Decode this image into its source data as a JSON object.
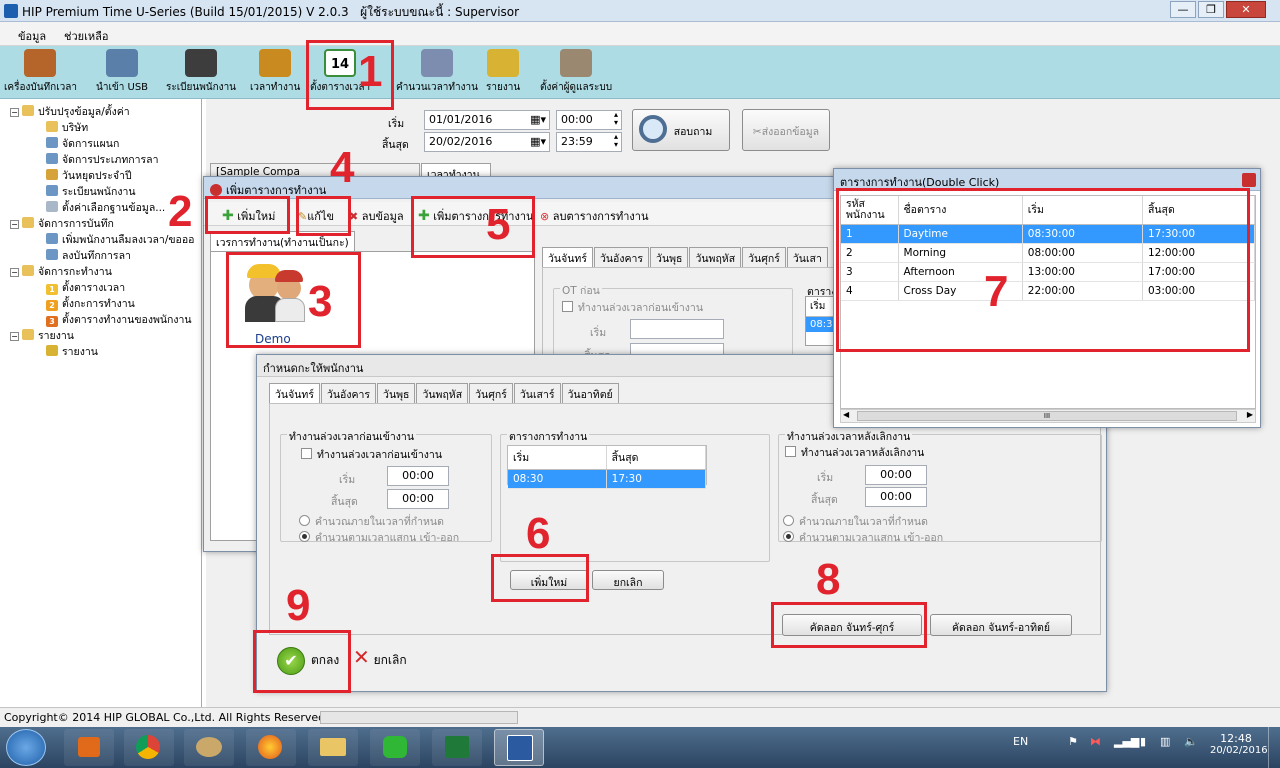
{
  "app": {
    "title": "HIP Premium Time U-Series (Build 15/01/2015) V 2.0.3",
    "user_label": "ผู้ใช้ระบบขณะนี้",
    "user": ": Supervisor"
  },
  "window_buttons": {
    "min": "—",
    "max": "❐",
    "close": "✕"
  },
  "menu": [
    "ข้อมูล",
    "ช่วยเหลือ"
  ],
  "toolbar": [
    {
      "label": "เครื่องบันทึกเวลา",
      "icon": "time-clock-icon",
      "color": "#b5652a"
    },
    {
      "label": "นำเข้า USB",
      "icon": "usb-icon",
      "color": "#5a7fa8"
    },
    {
      "label": "ระเบียนพนักงาน",
      "icon": "employees-icon",
      "color": "#3d3d3d"
    },
    {
      "label": "เวลาทำงาน",
      "icon": "stopwatch-icon",
      "color": "#c98a1f"
    },
    {
      "label": "ตั้งตารางเวลา",
      "icon": "calendar-icon",
      "color": "#3a8d3a",
      "cal_day": "14"
    },
    {
      "label": "คำนวนเวลาทำงาน",
      "icon": "document-pen-icon",
      "color": "#7d8db0"
    },
    {
      "label": "รายงาน",
      "icon": "chart-icon",
      "color": "#d8b233"
    },
    {
      "label": "ตั้งค่าผู้ดูแลระบบ",
      "icon": "admin-settings-icon",
      "color": "#9a8870"
    }
  ],
  "tree": [
    {
      "label": "ปรับปรุงข้อมูล/ตั้งค่า",
      "level": 0,
      "exp": "−",
      "color": "#e8c15a"
    },
    {
      "label": "บริษัท",
      "level": 1,
      "color": "#e8c15a"
    },
    {
      "label": "จัดการแผนก",
      "level": 1,
      "color": "#6c96c4"
    },
    {
      "label": "จัดการประเภทการลา",
      "level": 1,
      "color": "#6c96c4"
    },
    {
      "label": "วันหยุดประจำปี",
      "level": 1,
      "color": "#d6a23a"
    },
    {
      "label": "ระเบียนพนักงาน",
      "level": 1,
      "color": "#6c96c4"
    },
    {
      "label": "ตั้งค่าเลือกฐานข้อมูล...",
      "level": 1,
      "color": "#a9b8c8"
    },
    {
      "label": "จัดการการบันทึก",
      "level": 0,
      "exp": "−",
      "color": "#e8c15a"
    },
    {
      "label": "เพิ่มพนักงานลืมลงเวลา/ขอออ",
      "level": 1,
      "color": "#6c96c4"
    },
    {
      "label": "ลงบันทึกการลา",
      "level": 1,
      "color": "#6c96c4"
    },
    {
      "label": "จัดการกะทำงาน",
      "level": 0,
      "exp": "−",
      "color": "#e8c15a"
    },
    {
      "label": "ตั้งตารางเวลา",
      "level": 1,
      "badge": "1",
      "color": "#f0c030"
    },
    {
      "label": "ตั้งกะการทำงาน",
      "level": 1,
      "badge": "2",
      "color": "#f0a020"
    },
    {
      "label": "ตั้งตารางทำงานของพนักงาน",
      "level": 1,
      "badge": "3",
      "color": "#e07020"
    },
    {
      "label": "รายงาน",
      "level": 0,
      "exp": "−",
      "color": "#e8c15a"
    },
    {
      "label": "รายงาน",
      "level": 1,
      "color": "#d8b233"
    }
  ],
  "search": {
    "start_label": "เริ่ม",
    "end_label": "สิ้นสุด",
    "start_date": "01/01/2016",
    "end_date": "20/02/2016",
    "start_time": "00:00",
    "end_time": "23:59",
    "query_button": "สอบถาม",
    "export_button": "ส่งออกข้อมูล"
  },
  "background_tabs": [
    "[Sample Compa",
    "เวลาทำงาน"
  ],
  "add_shift_window": {
    "title": "เพิ่มตารางการทำงาน",
    "toolbar": {
      "add": "เพิ่มใหม่",
      "edit": "แก้ไข",
      "delete": "ลบข้อมูล",
      "add_schedule": "เพิ่มตารางการทำงาน",
      "delete_schedule": "ลบตารางการทำงาน"
    },
    "list_tab": "เวรการทำงาน(ทำงานเป็นกะ)",
    "item_name": "Demo",
    "day_tabs": [
      "วันจันทร์",
      "วันอังคาร",
      "วันพุธ",
      "วันพฤหัส",
      "วันศุกร์",
      "วันเสา"
    ],
    "ot_group": "OT ก่อน",
    "ot_check": "ทำงานล่วงเวลาก่อนเข้างาน",
    "start": "เริ่ม",
    "end": "สิ้นสุด",
    "sched_group": "ตาราง",
    "sched_start": "เริ่ม",
    "sched_value": "08:3"
  },
  "assign_window": {
    "title": "กำหนดกะให้พนักงาน",
    "day_tabs": [
      "วันจันทร์",
      "วันอังคาร",
      "วันพุธ",
      "วันพฤหัส",
      "วันศุกร์",
      "วันเสาร์",
      "วันอาทิตย์"
    ],
    "ot_before": {
      "group": "ทำงานล่วงเวลาก่อนเข้างาน",
      "check": "ทำงานล่วงเวลาก่อนเข้างาน",
      "start_label": "เริ่ม",
      "end_label": "สิ้นสุด",
      "start": "00:00",
      "end": "00:00",
      "radio1": "คำนวณภายในเวลาที่กำหนด",
      "radio2": "คำนวนตามเวลาแสกน เข้า-ออก"
    },
    "schedule": {
      "group": "ตารางการทำงาน",
      "col_start": "เริ่ม",
      "col_end": "สิ้นสุด",
      "start": "08:30",
      "end": "17:30"
    },
    "ot_after": {
      "group": "ทำงานล่วงเวลาหลังเลิกงาน",
      "check": "ทำงานล่วงเวลาหลังเลิกงาน",
      "start_label": "เริ่ม",
      "end_label": "สิ้นสุด",
      "start": "00:00",
      "end": "00:00",
      "radio1": "คำนวณภายในเวลาที่กำหนด",
      "radio2": "คำนวนตามเวลาแสกน เข้า-ออก"
    },
    "add_button": "เพิ่มใหม่",
    "cancel_button": "ยกเลิก",
    "copy_mon_fri": "คัดลอก จันทร์-ศุกร์",
    "copy_mon_sun": "คัดลอก จันทร์-อาทิตย์",
    "ok_button": "ตกลง",
    "cancel2_button": "ยกเลิก"
  },
  "schedule_window": {
    "title": "ตารางการทำงาน(Double Click)",
    "columns": [
      "รหัส\nพนักงาน",
      "ชื่อตาราง",
      "เริ่ม",
      "สิ้นสุด"
    ],
    "rows": [
      {
        "id": "1",
        "name": "Daytime",
        "start": "08:30:00",
        "end": "17:30:00"
      },
      {
        "id": "2",
        "name": "Morning",
        "start": "08:00:00",
        "end": "12:00:00"
      },
      {
        "id": "3",
        "name": "Afternoon",
        "start": "13:00:00",
        "end": "17:00:00"
      },
      {
        "id": "4",
        "name": "Cross Day",
        "start": "22:00:00",
        "end": "03:00:00"
      }
    ],
    "scroll_thumb": "III"
  },
  "annotations": [
    "1",
    "2",
    "3",
    "4",
    "5",
    "6",
    "7",
    "8",
    "9"
  ],
  "status": {
    "copyright": "Copyright© 2014 HIP GLOBAL Co.,Ltd. All Rights Reserved"
  },
  "taskbar": {
    "lang": "EN",
    "time": "12:48",
    "date": "20/02/2016"
  }
}
